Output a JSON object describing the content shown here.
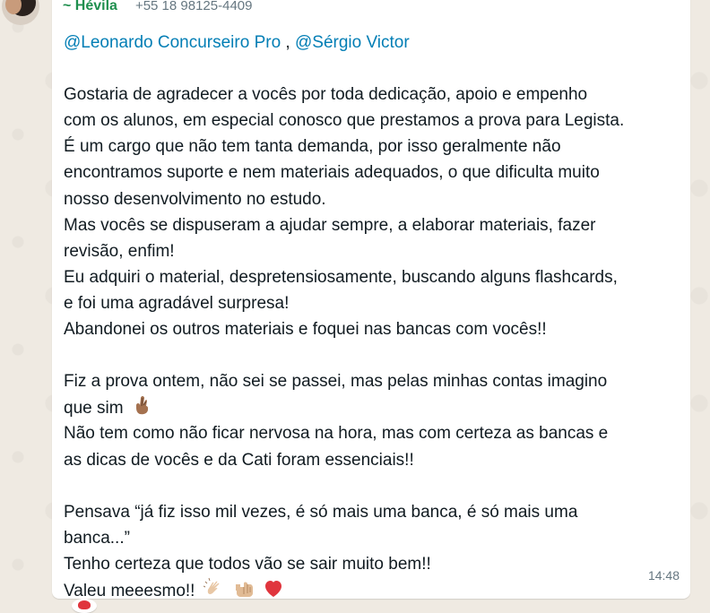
{
  "chat": {
    "sender_name": "~ Hévila",
    "sender_phone": "+55 18 98125-4409",
    "mentions": [
      "@Leonardo Concurseiro Pro",
      "@Sérgio Victor"
    ],
    "mention_separator": " , ",
    "paragraph1": [
      "Gostaria de agradecer a vocês por toda dedicação, apoio e empenho",
      "com os alunos, em especial conosco que prestamos a prova para Legista.",
      "É um cargo que não tem tanta demanda, por isso geralmente não",
      "encontramos suporte e nem materiais adequados, o que dificulta muito",
      "nosso desenvolvimento no estudo.",
      "Mas vocês se dispuseram a ajudar sempre, a elaborar materiais, fazer",
      "revisão, enfim!",
      "Eu adquiri o material, despretensiosamente, buscando alguns flashcards,",
      "e foi uma agradável surpresa!",
      "Abandonei os outros materiais e foquei nas bancas com vocês!!"
    ],
    "paragraph2": [
      "Fiz a prova ontem, não sei se passei, mas pelas minhas contas imagino",
      "que sim",
      "Não tem como não ficar nervosa na hora, mas com certeza as bancas e",
      "as dicas de vocês e da Cati foram essenciais!!"
    ],
    "paragraph3": [
      "Pensava “já fiz isso mil vezes, é só mais uma banca, é só mais uma",
      "banca...”",
      "Tenho certeza que todos vão se sair muito bem!!",
      "Valeu meeesmo!!"
    ],
    "emoji_icons": [
      "crossed-fingers-icon",
      "clapping-hands-icon",
      "fist-bump-icon",
      "red-heart-icon"
    ],
    "timestamp": "14:48",
    "colors": {
      "background": "#efeae2",
      "bubble": "#ffffff",
      "sender": "#1f8f4e",
      "mention": "#027eb5",
      "text": "#111b21",
      "muted": "#667781"
    }
  }
}
